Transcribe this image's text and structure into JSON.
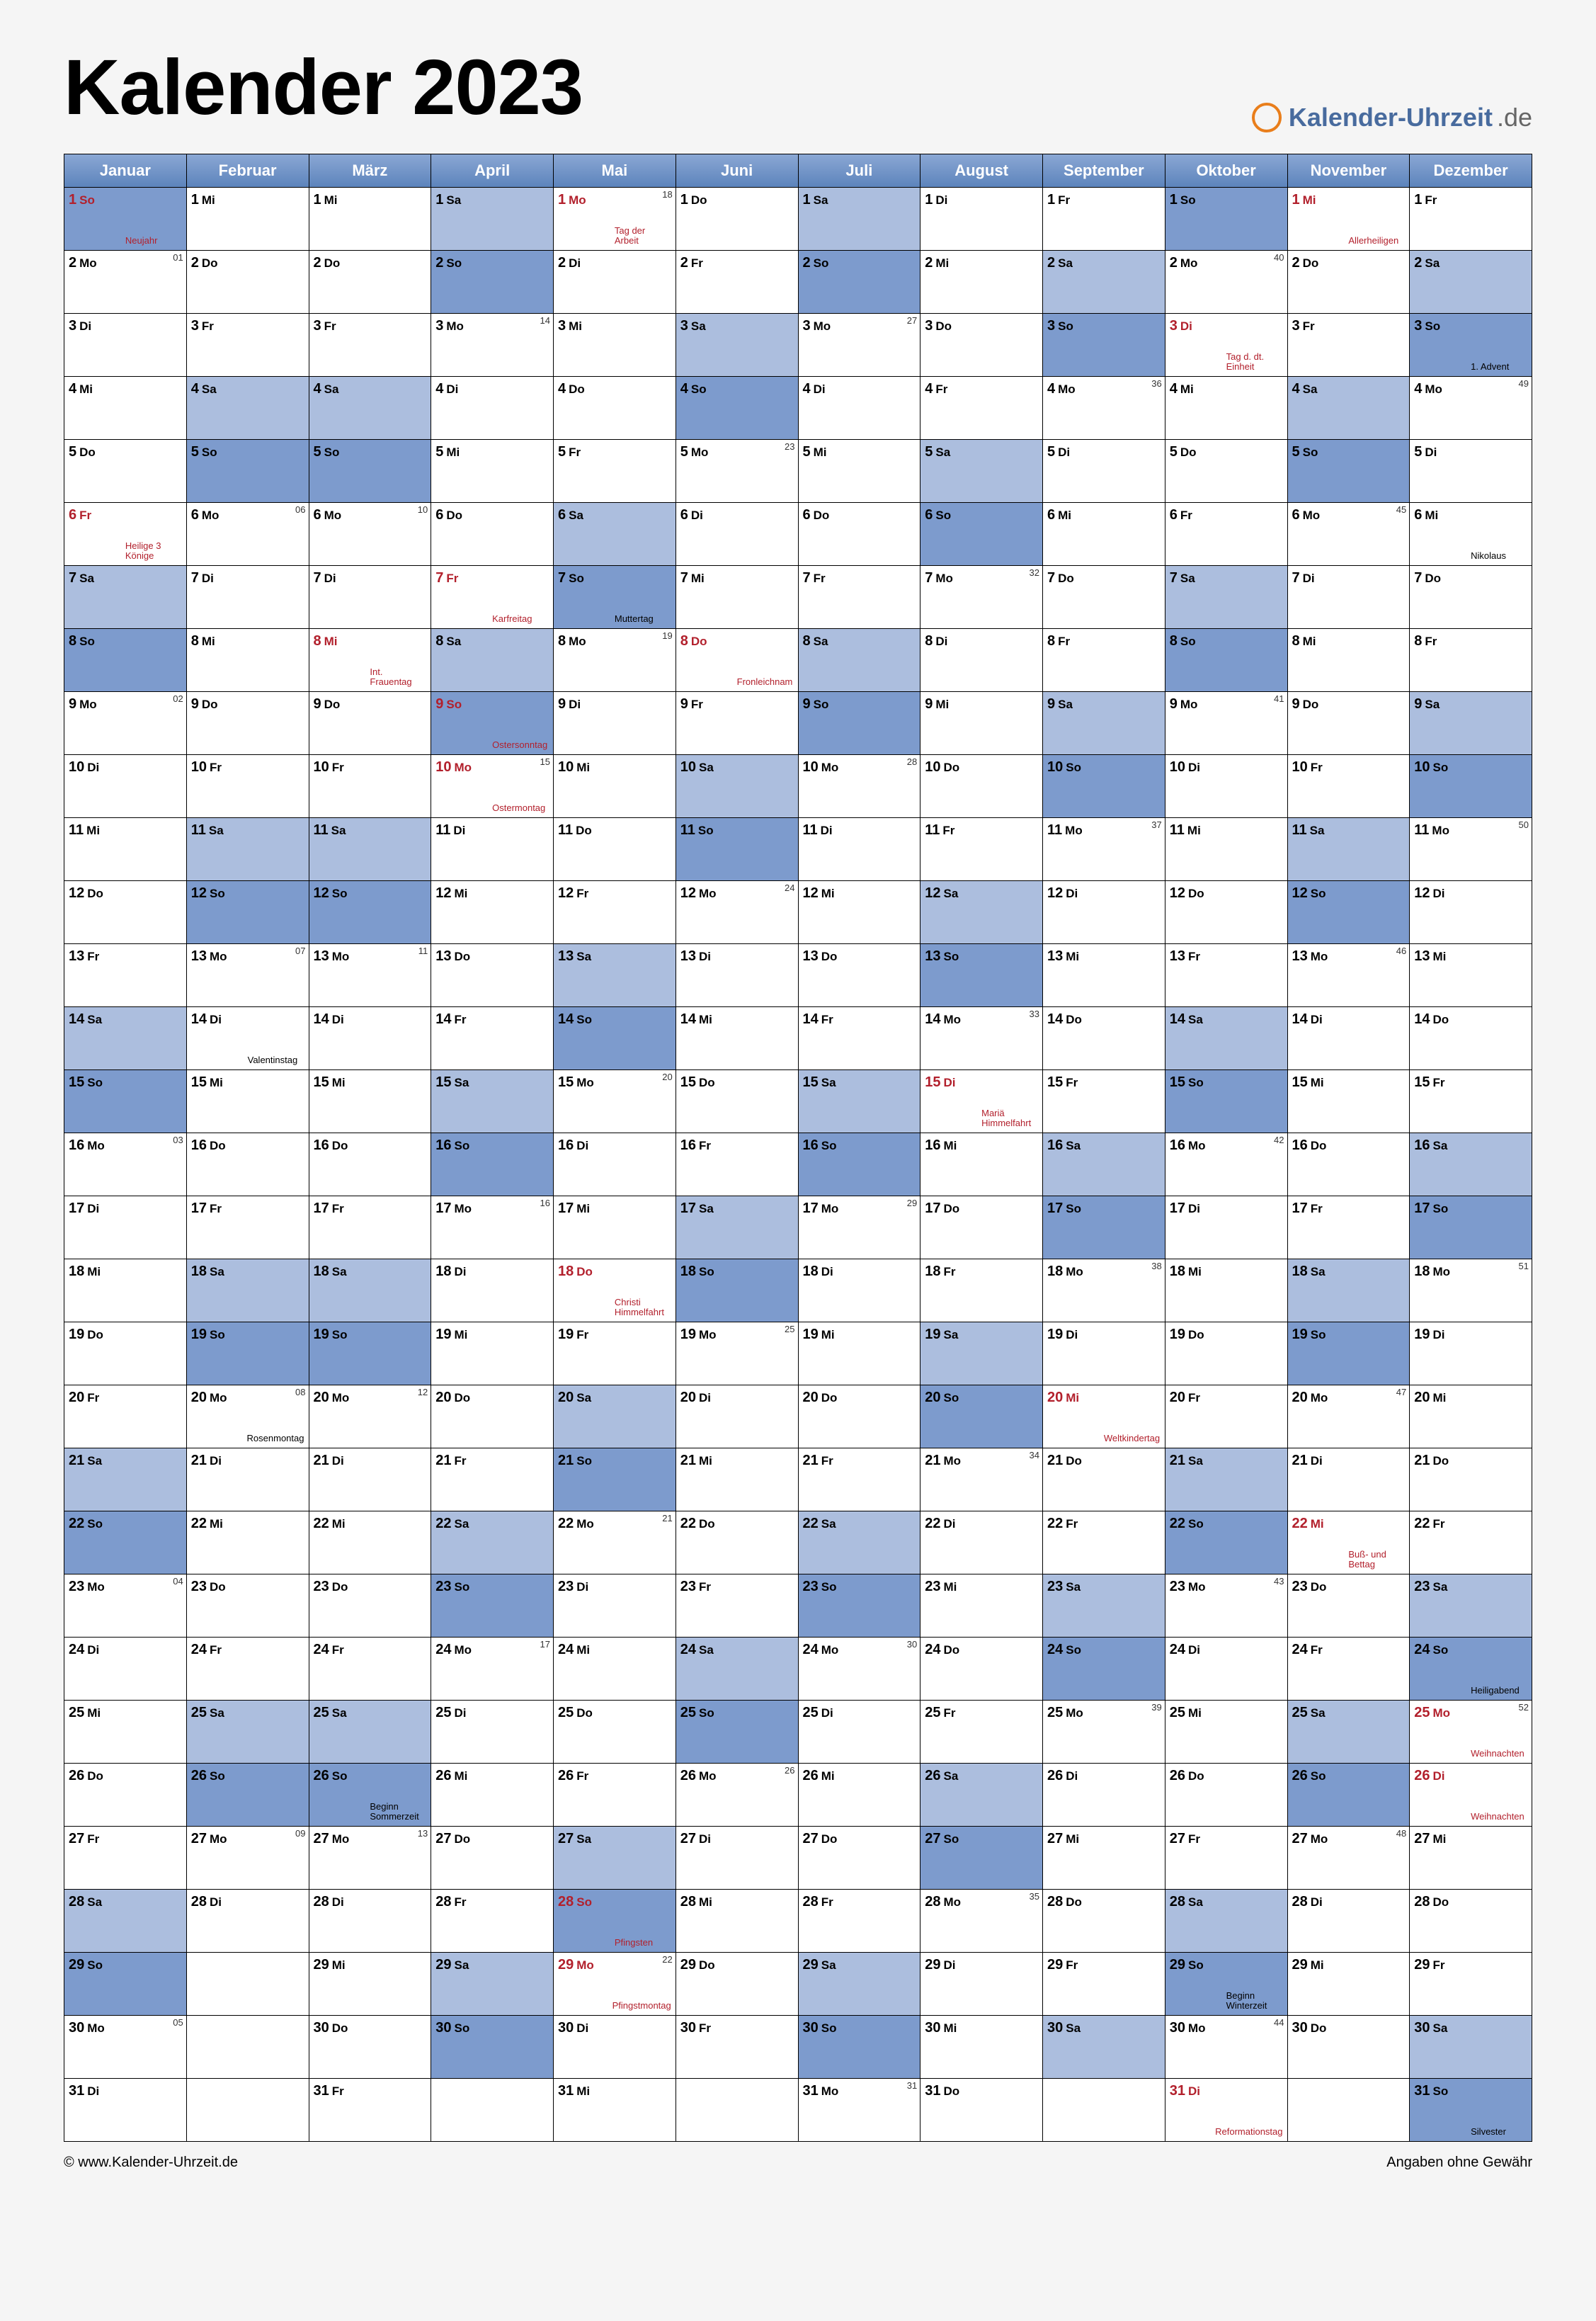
{
  "title": "Kalender 2023",
  "logo": {
    "text": "Kalender-Uhrzeit",
    "suffix": ".de"
  },
  "footer": {
    "left": "© www.Kalender-Uhrzeit.de",
    "right": "Angaben ohne Gewähr"
  },
  "weekdays": [
    "Mo",
    "Di",
    "Mi",
    "Do",
    "Fr",
    "Sa",
    "So"
  ],
  "months": [
    {
      "name": "Januar",
      "startWd": 6,
      "days": 31,
      "holidays": {
        "1": "Neujahr",
        "6": "Heilige 3 Könige"
      },
      "weeks": {
        "2": "01",
        "9": "02",
        "16": "03",
        "23": "04",
        "30": "05"
      }
    },
    {
      "name": "Februar",
      "startWd": 2,
      "days": 28,
      "events": {
        "14": "Valentinstag",
        "20": "Rosenmontag"
      },
      "weeks": {
        "6": "06",
        "13": "07",
        "20": "08",
        "27": "09"
      }
    },
    {
      "name": "März",
      "startWd": 2,
      "days": 31,
      "events": {
        "8": "Int. Frauentag",
        "26": "Beginn Sommerzeit"
      },
      "holidayDays": {
        "8": true
      },
      "weeks": {
        "6": "10",
        "13": "11",
        "20": "12",
        "27": "13"
      }
    },
    {
      "name": "April",
      "startWd": 5,
      "days": 30,
      "holidays": {
        "7": "Karfreitag",
        "9": "Ostersonntag",
        "10": "Ostermontag"
      },
      "weeks": {
        "3": "14",
        "10": "15",
        "17": "16",
        "24": "17"
      }
    },
    {
      "name": "Mai",
      "startWd": 0,
      "days": 31,
      "holidays": {
        "1": "Tag der Arbeit",
        "18": "Christi Himmelfahrt",
        "28": "Pfingsten",
        "29": "Pfingstmontag"
      },
      "events": {
        "7": "Muttertag"
      },
      "weeks": {
        "1": "18",
        "8": "19",
        "15": "20",
        "22": "21",
        "29": "22"
      }
    },
    {
      "name": "Juni",
      "startWd": 3,
      "days": 30,
      "holidays": {
        "8": "Fronleichnam"
      },
      "weeks": {
        "5": "23",
        "12": "24",
        "19": "25",
        "26": "26"
      }
    },
    {
      "name": "Juli",
      "startWd": 5,
      "days": 31,
      "weeks": {
        "3": "27",
        "10": "28",
        "17": "29",
        "24": "30",
        "31": "31"
      }
    },
    {
      "name": "August",
      "startWd": 1,
      "days": 31,
      "holidays": {
        "15": "Mariä Himmelfahrt"
      },
      "weeks": {
        "7": "32",
        "14": "33",
        "21": "34",
        "28": "35"
      }
    },
    {
      "name": "September",
      "startWd": 4,
      "days": 30,
      "events": {
        "20": "Weltkindertag"
      },
      "holidayDays": {
        "20": true
      },
      "weeks": {
        "4": "36",
        "11": "37",
        "18": "38",
        "25": "39"
      }
    },
    {
      "name": "Oktober",
      "startWd": 6,
      "days": 31,
      "holidays": {
        "3": "Tag d. dt. Einheit",
        "31": "Reformationstag"
      },
      "events": {
        "29": "Beginn Winterzeit"
      },
      "weeks": {
        "2": "40",
        "9": "41",
        "16": "42",
        "23": "43",
        "30": "44"
      }
    },
    {
      "name": "November",
      "startWd": 2,
      "days": 30,
      "holidays": {
        "1": "Allerheiligen",
        "22": "Buß- und Bettag"
      },
      "weeks": {
        "6": "45",
        "13": "46",
        "20": "47",
        "27": "48"
      }
    },
    {
      "name": "Dezember",
      "startWd": 4,
      "days": 31,
      "holidays": {
        "25": "Weihnachten",
        "26": "Weihnachten"
      },
      "events": {
        "3": "1. Advent",
        "6": "Nikolaus",
        "24": "Heiligabend",
        "31": "Silvester"
      },
      "weeks": {
        "4": "49",
        "11": "50",
        "18": "51",
        "25": "52"
      }
    }
  ]
}
